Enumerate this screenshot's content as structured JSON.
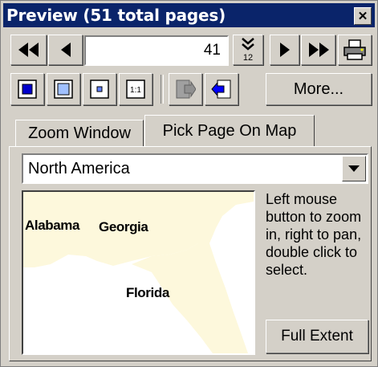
{
  "window": {
    "title": "Preview (51 total pages)"
  },
  "navigation": {
    "page_number": "41",
    "more_label": "More..."
  },
  "tabs": [
    {
      "label": "Zoom Window",
      "active": false
    },
    {
      "label": "Pick Page On Map",
      "active": true
    }
  ],
  "region_select": {
    "value": "North America"
  },
  "map": {
    "labels": [
      "Alabama",
      "Georgia",
      "Florida"
    ],
    "land_color": "#fdf8dc"
  },
  "hint_text": "Left mouse button to zoom in, right to pan, double click to select.",
  "full_extent_label": "Full Extent",
  "icons": [
    "first-page-icon",
    "previous-page-icon",
    "go-to-page-icon",
    "next-page-icon",
    "last-page-icon",
    "print-icon",
    "zoom-full-icon",
    "zoom-in-icon",
    "zoom-out-icon",
    "actual-size-icon",
    "export-icon",
    "import-icon",
    "close-icon",
    "dropdown-arrow-icon"
  ]
}
